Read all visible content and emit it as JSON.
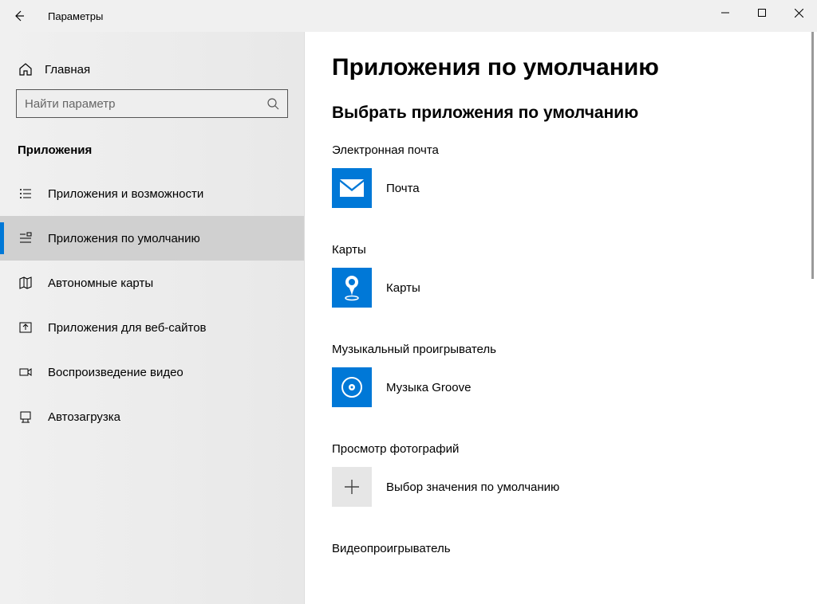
{
  "window": {
    "title": "Параметры"
  },
  "sidebar": {
    "home": "Главная",
    "search_placeholder": "Найти параметр",
    "section": "Приложения",
    "items": [
      {
        "label": "Приложения и возможности"
      },
      {
        "label": "Приложения по умолчанию"
      },
      {
        "label": "Автономные карты"
      },
      {
        "label": "Приложения для веб-сайтов"
      },
      {
        "label": "Воспроизведение видео"
      },
      {
        "label": "Автозагрузка"
      }
    ]
  },
  "main": {
    "title": "Приложения по умолчанию",
    "subtitle": "Выбрать приложения по умолчанию",
    "defaults": [
      {
        "category": "Электронная почта",
        "app": "Почта",
        "icon": "mail",
        "tile": "blue"
      },
      {
        "category": "Карты",
        "app": "Карты",
        "icon": "maps",
        "tile": "blue"
      },
      {
        "category": "Музыкальный проигрыватель",
        "app": "Музыка Groove",
        "icon": "groove",
        "tile": "blue"
      },
      {
        "category": "Просмотр фотографий",
        "app": "Выбор значения по умолчанию",
        "icon": "plus",
        "tile": "gray"
      },
      {
        "category": "Видеопроигрыватель",
        "app": "",
        "icon": "",
        "tile": ""
      }
    ]
  }
}
